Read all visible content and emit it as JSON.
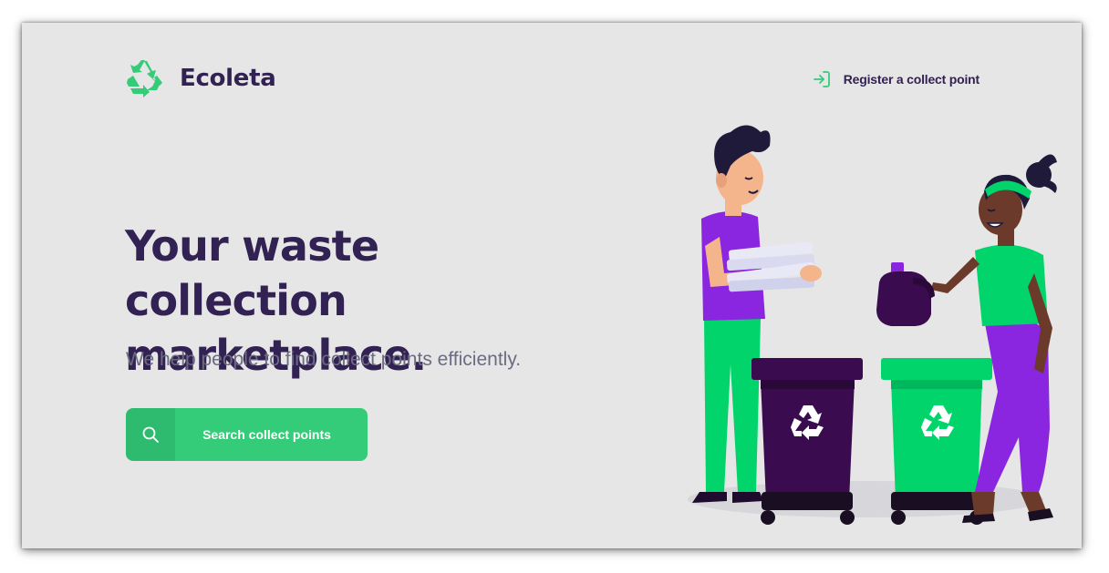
{
  "brand": {
    "name": "Ecoleta",
    "logo_icon": "recycle-icon",
    "primary_color": "#34cb79",
    "title_color": "#322153"
  },
  "header": {
    "register_label": "Register a collect point",
    "register_icon": "log-in-icon"
  },
  "hero": {
    "title": "Your waste collection marketplace.",
    "subtitle": "We help people to find collect points efficiently.",
    "search_button": {
      "label": "Search collect points",
      "icon": "search-icon"
    }
  },
  "illustration": {
    "name": "people-recycling-illustration",
    "colors": {
      "purple": "#8a26e0",
      "dark_purple": "#3b0b4f",
      "green": "#00d46a"
    }
  }
}
